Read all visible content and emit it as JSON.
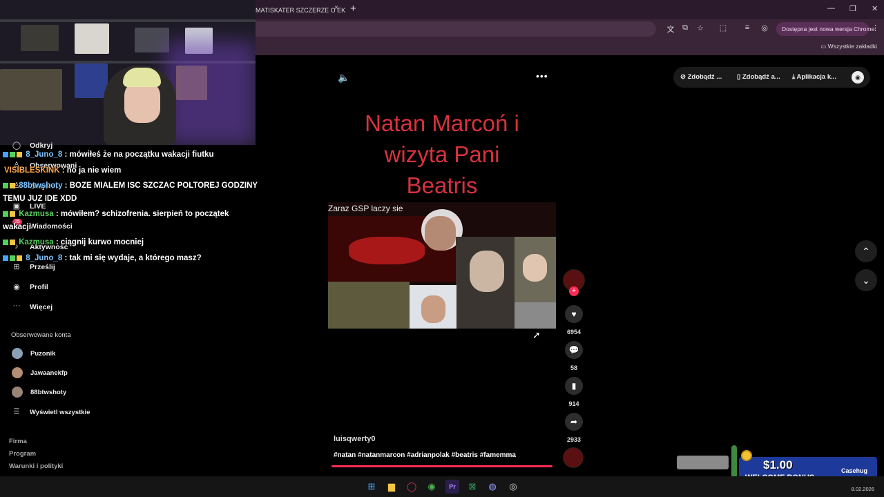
{
  "browser": {
    "tab_title": "MATISKATER SZCZERZE O EKIP",
    "tab_close": "×",
    "new_tab": "+",
    "window_controls": [
      "—",
      "❐",
      "✕"
    ],
    "update_label": "Dostępna jest nowa wersja Chrome",
    "menu": "⋮",
    "bookmarks_all": "Wszystkie zakładki"
  },
  "sidebar": {
    "items": [
      {
        "label": "Odkryj",
        "icon": "compass-icon"
      },
      {
        "label": "Obserwowani",
        "icon": "person-icon"
      },
      {
        "label": "Znajomi",
        "icon": "friends-icon"
      },
      {
        "label": "LIVE",
        "icon": "live-icon"
      },
      {
        "label": "Wiadomości",
        "icon": "message-icon"
      },
      {
        "label": "Aktywność",
        "icon": "bell-icon"
      },
      {
        "label": "Prześlij",
        "icon": "plus-square-icon"
      },
      {
        "label": "Profil",
        "icon": "avatar-icon"
      },
      {
        "label": "Więcej",
        "icon": "more-icon"
      }
    ],
    "badge": "25",
    "followed_heading": "Obserwowane konta",
    "followed": [
      {
        "name": "Puzonik"
      },
      {
        "name": "Jawaanekfp"
      },
      {
        "name": "88btwshoty"
      }
    ],
    "show_all": "Wyświetl wszystkie",
    "footer": [
      "Firma",
      "Program",
      "Warunki i polityki"
    ]
  },
  "chat": [
    {
      "user": "8_Juno_8",
      "text": ": mówiłeś że na początku wakacji fiutku",
      "color": "blue"
    },
    {
      "user": "VISIBLESKINK",
      "text": ": no ja nie wiem",
      "color": "orange"
    },
    {
      "user": "88btwshoty",
      "text": ": BOZE MIALEM ISC SZCZAC POLTOREJ GODZINY",
      "color": "blue"
    },
    {
      "user": "",
      "text": "TEMU JUZ IDE XDD",
      "color": "none"
    },
    {
      "user": "Kazmusa",
      "text": ": mówiłem? schizofrenia. sierpień to początek",
      "color": "green"
    },
    {
      "user": "",
      "text": "wakacji",
      "color": "none"
    },
    {
      "user": "Kazmusa",
      "text": ": ciągnij kurwo mocniej",
      "color": "green"
    },
    {
      "user": "8_Juno_8",
      "text": ": tak mi się wydaje, a którego masz?",
      "color": "blue"
    }
  ],
  "video": {
    "title_lines": [
      "Natan Marcoń i",
      "wizyta Pani",
      "Beatris"
    ],
    "overlay_text": "Zaraz GSP laczy sie",
    "author": "luisqwerty0",
    "hashtags": "#natan #natanmarcon #adrianpolak #beatris #famemma",
    "progress": 1.0
  },
  "rail": {
    "likes": "6954",
    "comments": "58",
    "saves": "914",
    "shares": "2933"
  },
  "get_bar": {
    "items": [
      "Zdobądź ...",
      "Zdobądź a...",
      "Aplikacja k..."
    ]
  },
  "ad": {
    "amount": "$1.00",
    "welcome": "WELCOME BONUS",
    "brand": "Casehug"
  },
  "taskbar": {
    "date": "8.02.2026"
  },
  "colors": {
    "accent": "#fe2c55",
    "title_red": "#d8323f",
    "chrome_bg": "#2b1a2c"
  }
}
